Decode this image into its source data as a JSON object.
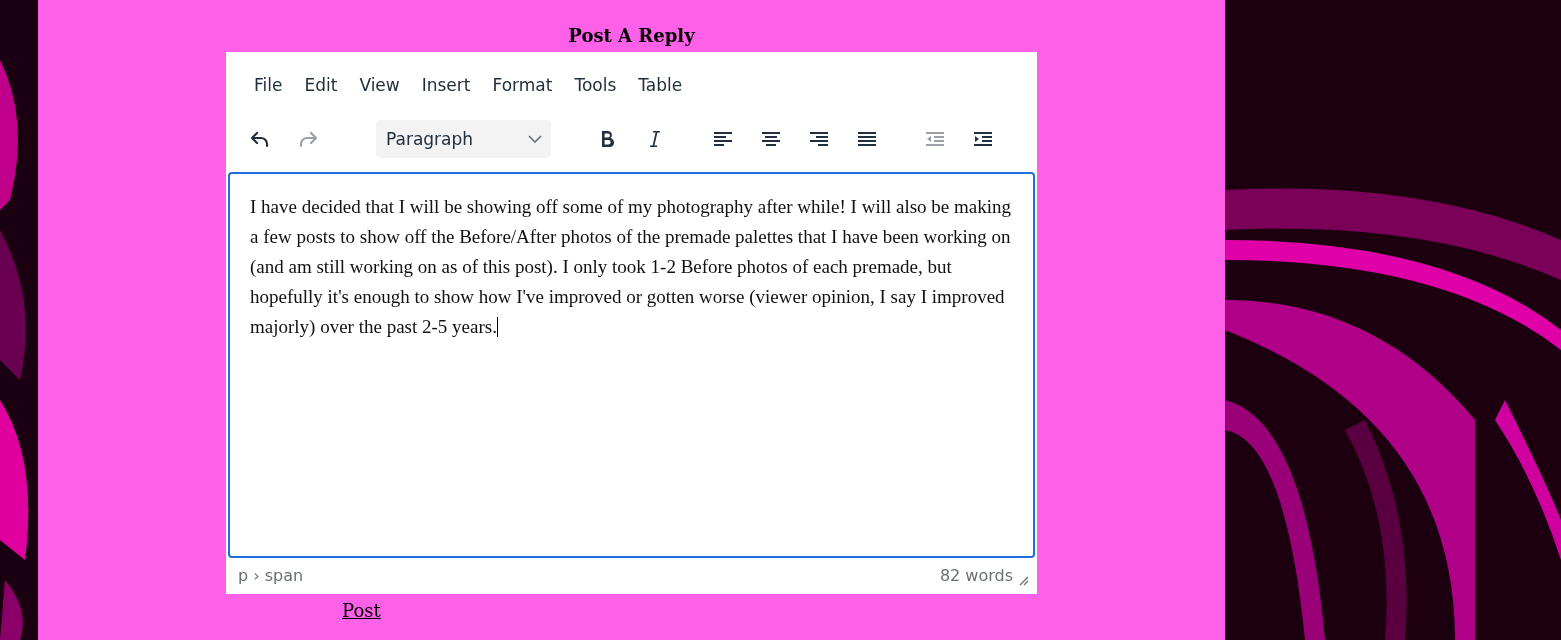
{
  "heading": "Post A Reply",
  "menu": [
    {
      "label": "File"
    },
    {
      "label": "Edit"
    },
    {
      "label": "View"
    },
    {
      "label": "Insert"
    },
    {
      "label": "Format"
    },
    {
      "label": "Tools"
    },
    {
      "label": "Table"
    }
  ],
  "toolbar": [
    {
      "kind": "undo",
      "disabled": false
    },
    {
      "kind": "redo",
      "disabled": true
    },
    {
      "kind": "block-format",
      "value": "Paragraph"
    },
    {
      "kind": "bold",
      "disabled": false
    },
    {
      "kind": "italic",
      "disabled": false
    },
    {
      "kind": "align-left",
      "disabled": false
    },
    {
      "kind": "align-center",
      "disabled": false
    },
    {
      "kind": "align-right",
      "disabled": false
    },
    {
      "kind": "justify",
      "disabled": false
    },
    {
      "kind": "outdent",
      "disabled": true
    },
    {
      "kind": "indent",
      "disabled": false
    }
  ],
  "editor": {
    "text": "I have decided that I will be showing off some of my photography after while! I will also be making a few posts to show off the Before/After photos of the premade palettes that I have been working on (and am still working on as of this post). I only took 1-2 Before photos of each premade, but hopefully it's enough to show how I've improved or gotten worse (viewer opinion, I say I improved majorly) over the past 2-5 years.",
    "focused": true
  },
  "status_bar": {
    "path": "p › span",
    "word_count": "82 words"
  },
  "post_link": "Post"
}
